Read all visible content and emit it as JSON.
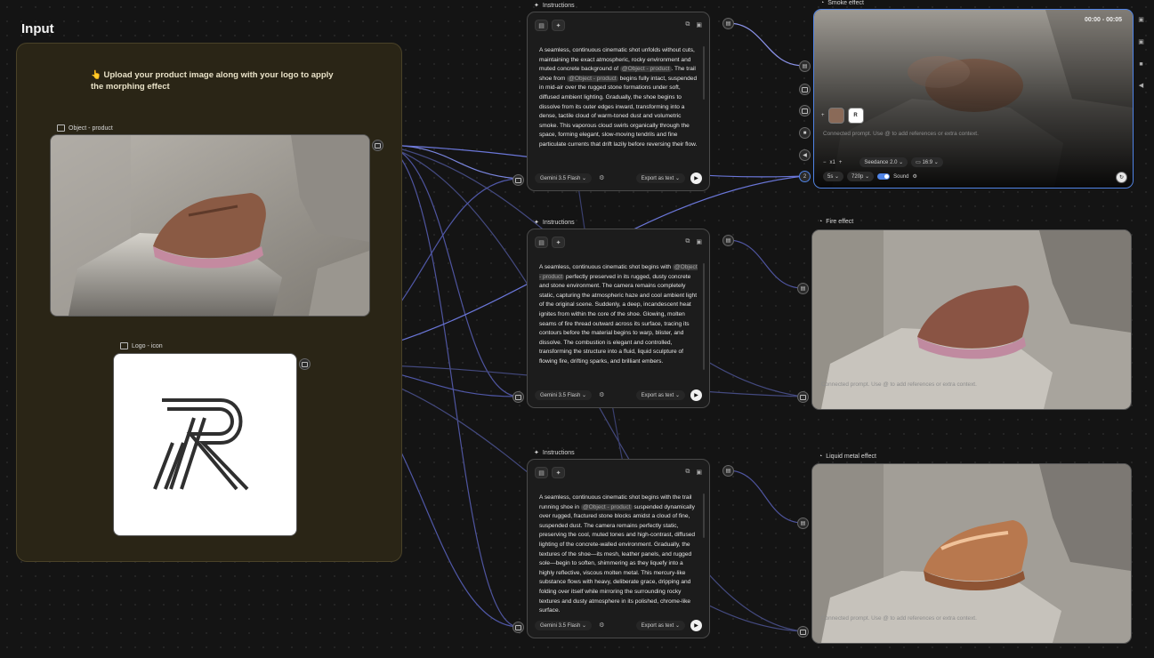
{
  "input_group": {
    "title": "Input",
    "note": "Upload your product image along with your logo to apply the morphing effect",
    "note_icon": "👆",
    "object_label": "Object - product",
    "logo_label": "Logo - icon"
  },
  "instructions": [
    {
      "label": "Instructions",
      "segments": [
        {
          "t": "A seamless, continuous cinematic shot unfolds without cuts, maintaining the exact atmospheric, rocky environment and muted concrete background of "
        },
        {
          "t": "@Object - product",
          "m": true
        },
        {
          "t": ". The trail shoe from "
        },
        {
          "t": "@Object - product",
          "m": true
        },
        {
          "t": " begins fully intact, suspended in mid-air over the rugged stone formations under soft, diffused ambient lighting. Gradually, the shoe begins to dissolve from its outer edges inward, transforming into a dense, tactile cloud of warm-toned dust and volumetric smoke. This vaporous cloud swirls organically through the space, forming elegant, slow-moving tendrils and fine particulate currents that drift lazily before reversing their flow."
        }
      ],
      "model": "Gemini 3.5 Flash",
      "export": "Export as text"
    },
    {
      "label": "Instructions",
      "segments": [
        {
          "t": "A seamless, continuous cinematic shot begins with "
        },
        {
          "t": "@Object - product",
          "m": true
        },
        {
          "t": " perfectly preserved in its rugged, dusty concrete and stone environment. The camera remains completely static, capturing the atmospheric haze and cool ambient light of the original scene. Suddenly, a deep, incandescent heat ignites from within the core of the shoe. Glowing, molten seams of fire thread outward across its surface, tracing its contours before the material begins to warp, blister, and dissolve. The combustion is elegant and controlled, transforming the structure into a fluid, liquid sculpture of flowing fire, drifting sparks, and brilliant embers."
        }
      ],
      "model": "Gemini 3.5 Flash",
      "export": "Export as text"
    },
    {
      "label": "Instructions",
      "segments": [
        {
          "t": "A seamless, continuous cinematic shot begins with the trail running shoe in "
        },
        {
          "t": "@Object - product",
          "m": true
        },
        {
          "t": " suspended dynamically over rugged, fractured stone blocks amidst a cloud of fine, suspended dust. The camera remains perfectly static, preserving the cool, muted tones and high-contrast, diffused lighting of the concrete-walled environment. Gradually, the textures of the shoe—its mesh, leather panels, and rugged sole—begin to soften, shimmering as they liquefy into a highly reflective, viscous molten metal. This mercury-like substance flows with heavy, deliberate grace, dripping and folding over itself while mirroring the surrounding rocky textures and dusty atmosphere in its polished, chrome-like surface."
        }
      ],
      "model": "Gemini 3.5 Flash",
      "export": "Export as text"
    }
  ],
  "outputs": {
    "smoke": {
      "label": "Smoke effect",
      "time": "00:00 - 00:05",
      "prompt_hint": "Connected prompt. Use @ to add references or extra context.",
      "count": "x1",
      "model": "Seedance 2.0",
      "ratio": "16:9",
      "duration": "5s",
      "resolution": "720p",
      "sound": "Sound",
      "port_count": "2",
      "add": "+"
    },
    "fire": {
      "label": "Fire effect",
      "prompt_hint": "Connected prompt. Use @ to add references or extra context."
    },
    "liquid": {
      "label": "Liquid metal effect",
      "prompt_hint": "Connected prompt. Use @ to add references or extra context."
    }
  },
  "colors": {
    "accent": "#4f83e6",
    "group_bg": "#2a2516",
    "canvas": "#141414"
  }
}
